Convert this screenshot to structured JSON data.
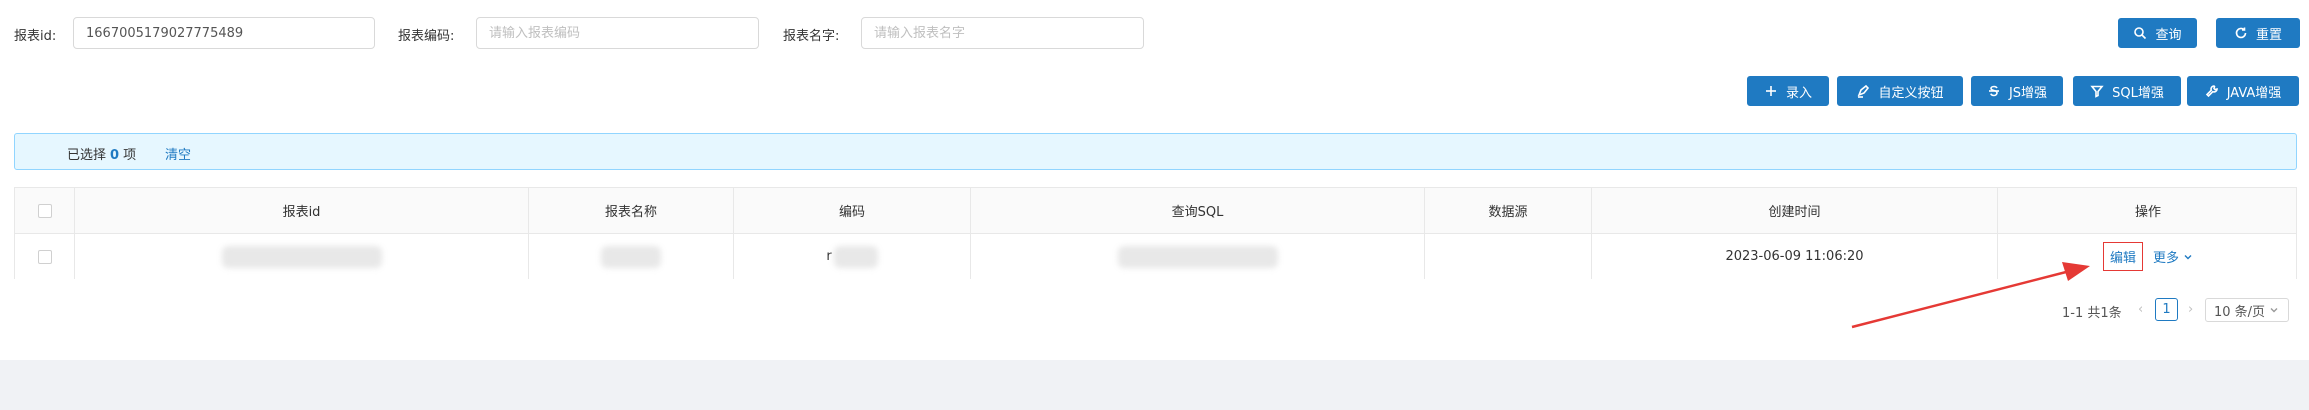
{
  "search": {
    "report_id_label": "报表id:",
    "report_id_value": "1667005179027775489",
    "report_code_label": "报表编码:",
    "report_code_placeholder": "请输入报表编码",
    "report_name_label": "报表名字:",
    "report_name_placeholder": "请输入报表名字",
    "query_button": "查询",
    "reset_button": "重置"
  },
  "toolbar": {
    "add_button": "录入",
    "custom_button": "自定义按钮",
    "js_button": "JS增强",
    "sql_button": "SQL增强",
    "java_button": "JAVA增强"
  },
  "alert": {
    "selected_prefix": "已选择",
    "selected_count": "0",
    "selected_suffix": "项",
    "clear_link": "清空"
  },
  "table": {
    "columns": [
      "报表id",
      "报表名称",
      "编码",
      "查询SQL",
      "数据源",
      "创建时间",
      "操作"
    ],
    "rows": [
      {
        "code_fragment": "r",
        "created_at": "2023-06-09 11:06:20",
        "edit_action": "编辑",
        "more_action": "更多"
      }
    ]
  },
  "pagination": {
    "total_text": "1-1 共1条",
    "current_page": "1",
    "page_size": "10 条/页"
  },
  "colors": {
    "primary": "#1f7ac2",
    "annotation_red": "#e53935"
  }
}
